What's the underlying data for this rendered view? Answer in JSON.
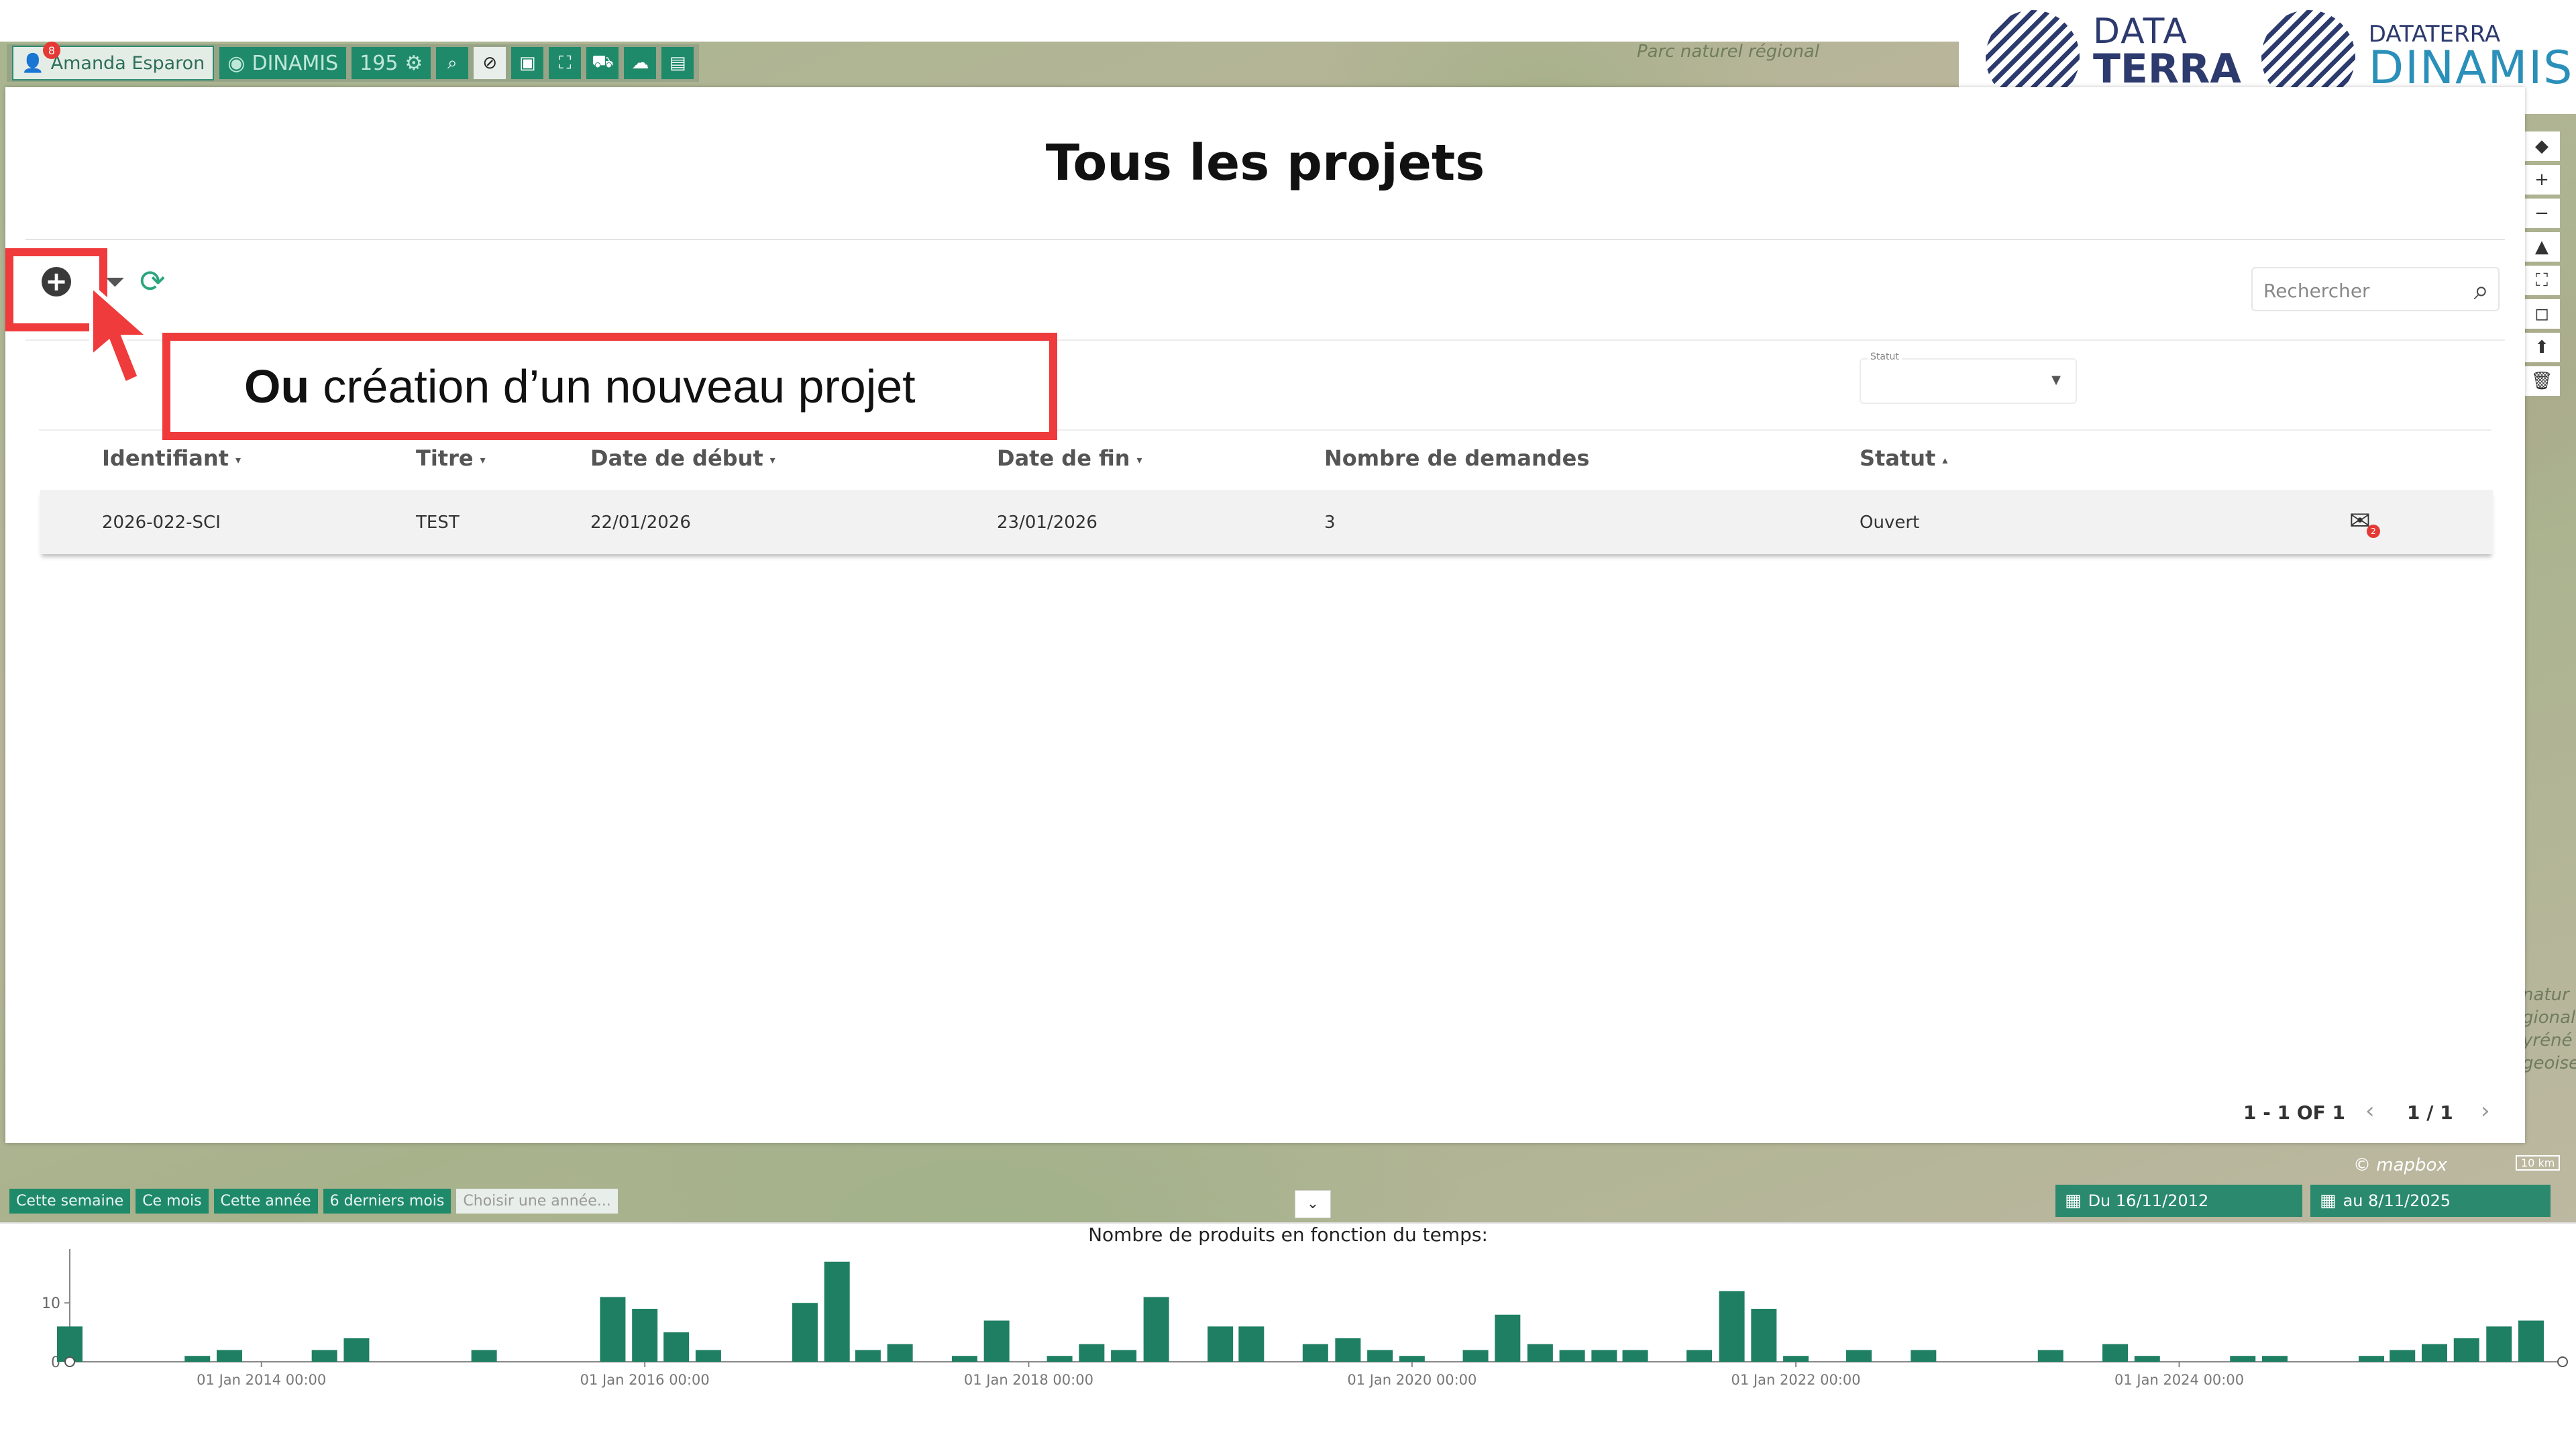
{
  "toolbar": {
    "user_name": "Amanda Esparon",
    "user_badge": "8",
    "app_name": "DINAMIS",
    "count": "195"
  },
  "logos": {
    "datatera_line1": "DATA",
    "datatera_line2": "TERRA",
    "dinamis_top": "DATATERRA",
    "dinamis_bottom": "DINAMIS",
    "dot_colors": [
      "#e95e2b",
      "#e8b21c",
      "#5aa545",
      "#3a8fd0",
      "#2c3a6e"
    ]
  },
  "map_labels": {
    "top": "Parc naturel régional",
    "right": "natur gional yréné geoise"
  },
  "modal": {
    "title": "Tous les projets",
    "search_placeholder": "Rechercher",
    "status_filter_label": "Statut",
    "columns": [
      {
        "label": "Identifiant",
        "sort": "▾"
      },
      {
        "label": "Titre",
        "sort": "▾"
      },
      {
        "label": "Date de début",
        "sort": "▾"
      },
      {
        "label": "Date de fin",
        "sort": "▾"
      },
      {
        "label": "Nombre de demandes",
        "sort": ""
      },
      {
        "label": "Statut",
        "sort": "▴"
      }
    ],
    "rows": [
      {
        "id": "2026-022-SCI",
        "titre": "TEST",
        "debut": "22/01/2026",
        "fin": "23/01/2026",
        "demandes": "3",
        "statut": "Ouvert",
        "badge": "2"
      }
    ],
    "pager": {
      "range": "1 - 1 OF 1",
      "page": "1 / 1"
    }
  },
  "annotation": {
    "callout_bold": "Ou",
    "callout_text": "création d’un nouveau projet",
    "color": "#ef3b3b"
  },
  "bottom": {
    "filters": [
      "Cette semaine",
      "Ce mois",
      "Cette année",
      "6 derniers mois"
    ],
    "year_placeholder": "Choisir une année...",
    "date_from": "Du 16/11/2012",
    "date_to": "au 8/11/2025",
    "mapbox": "© mapbox",
    "scale": "10 km"
  },
  "chart_data": {
    "type": "bar",
    "title": "Nombre de produits en fonction du temps:",
    "xlabel": "",
    "ylabel": "",
    "yticks": [
      0,
      10
    ],
    "ylim": [
      0,
      18
    ],
    "xlim": [
      "2013-01-01",
      "2025-12-31"
    ],
    "xticks": [
      {
        "date": "2014-01-01",
        "label": "01 Jan 2014 00:00"
      },
      {
        "date": "2016-01-01",
        "label": "01 Jan 2016 00:00"
      },
      {
        "date": "2018-01-01",
        "label": "01 Jan 2018 00:00"
      },
      {
        "date": "2020-01-01",
        "label": "01 Jan 2020 00:00"
      },
      {
        "date": "2022-01-01",
        "label": "01 Jan 2022 00:00"
      },
      {
        "date": "2024-01-01",
        "label": "01 Jan 2024 00:00"
      }
    ],
    "bar_color": "#1f7f63",
    "series": [
      {
        "dates": [
          "2013-01",
          "2013-09",
          "2013-11",
          "2014-05",
          "2014-07",
          "2015-03",
          "2015-11",
          "2016-01",
          "2016-03",
          "2016-05",
          "2016-11",
          "2017-01",
          "2017-03",
          "2017-05",
          "2017-09",
          "2017-11",
          "2018-03",
          "2018-05",
          "2018-07",
          "2018-09",
          "2019-01",
          "2019-03",
          "2019-07",
          "2019-09",
          "2019-11",
          "2020-01",
          "2020-05",
          "2020-07",
          "2020-09",
          "2020-11",
          "2021-01",
          "2021-03",
          "2021-07",
          "2021-09",
          "2021-11",
          "2022-01",
          "2022-05",
          "2022-09",
          "2023-05",
          "2023-09",
          "2023-11",
          "2024-05",
          "2024-07",
          "2025-01",
          "2025-03",
          "2025-05",
          "2025-07",
          "2025-09",
          "2025-11"
        ],
        "values": [
          6,
          1,
          2,
          2,
          4,
          2,
          11,
          9,
          5,
          2,
          10,
          17,
          2,
          3,
          1,
          7,
          1,
          3,
          2,
          11,
          6,
          6,
          3,
          4,
          2,
          1,
          2,
          8,
          3,
          2,
          2,
          2,
          2,
          12,
          9,
          1,
          2,
          2,
          2,
          3,
          1,
          1,
          1,
          1,
          2,
          3,
          4,
          6,
          7
        ]
      }
    ]
  }
}
